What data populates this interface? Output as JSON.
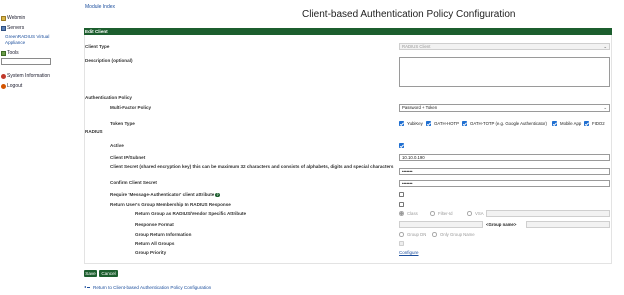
{
  "sidebar": {
    "webmin": "Webmin",
    "servers": "Servers",
    "servers_sub": "GreenRADIUS Virtual Appliance",
    "tools": "Tools",
    "search_value": "",
    "system_information": "System Information",
    "logout": "Logout"
  },
  "header": {
    "module_index": "Module Index",
    "title": "Client-based Authentication Policy Configuration"
  },
  "section": {
    "title": "Edit Client"
  },
  "form": {
    "client_type": {
      "label": "Client Type",
      "value": "RADIUS Client"
    },
    "description": {
      "label": "Description (optional)",
      "value": ""
    },
    "auth_policy": {
      "heading": "Authentication Policy"
    },
    "mfa_policy": {
      "label": "Multi-Factor Policy",
      "value": "Password + Token"
    },
    "token_type": {
      "label": "Token Type",
      "options": [
        {
          "label": "YubiKey",
          "checked": true
        },
        {
          "label": "OATH-HOTP",
          "checked": true
        },
        {
          "label": "OATH-TOTP (e.g. Google Authenticator)",
          "checked": true
        },
        {
          "label": "Mobile App",
          "checked": true
        },
        {
          "label": "FIDO2",
          "checked": true
        }
      ]
    },
    "radius": {
      "heading": "RADIUS"
    },
    "active": {
      "label": "Active",
      "checked": true
    },
    "client_ip": {
      "label": "Client IP/Subnet",
      "value": "10.10.0.190"
    },
    "client_secret": {
      "label": "Client Secret (shared encryption key) this can be maximum 32 characters and consists of alphabets, digits and special characters",
      "value": "•••••••"
    },
    "confirm_secret": {
      "label": "Confirm Client Secret",
      "value": "•••••••"
    },
    "require_msg_auth": {
      "label": "Require 'Message-Authenticator' client attribute",
      "help": "?",
      "checked": false
    },
    "return_groups": {
      "label": "Return User's Group Membership In RADIUS Response",
      "checked": false
    },
    "return_group_as": {
      "label": "Return Group as RADIUS/Vendor Specific Attribute",
      "options": [
        {
          "label": "Class",
          "selected": true
        },
        {
          "label": "Filter-Id",
          "selected": false
        },
        {
          "label": "VSA",
          "selected": false
        }
      ],
      "vsa_value": ""
    },
    "response_format": {
      "label": "Response Format",
      "prefix": "",
      "group_name": "<Group name>",
      "suffix": ""
    },
    "group_return_info": {
      "label": "Group Return Information",
      "options": [
        {
          "label": "Group DN",
          "selected": false
        },
        {
          "label": "Only Group Name",
          "selected": false
        }
      ]
    },
    "return_all_groups": {
      "label": "Return All Groups",
      "checked": false
    },
    "group_priority": {
      "label": "Group Priority",
      "link": "Configure"
    }
  },
  "buttons": {
    "save": "Save",
    "cancel": "Cancel"
  },
  "footer": {
    "return_link": "Return to Client-based Authentication Policy Configuration"
  }
}
